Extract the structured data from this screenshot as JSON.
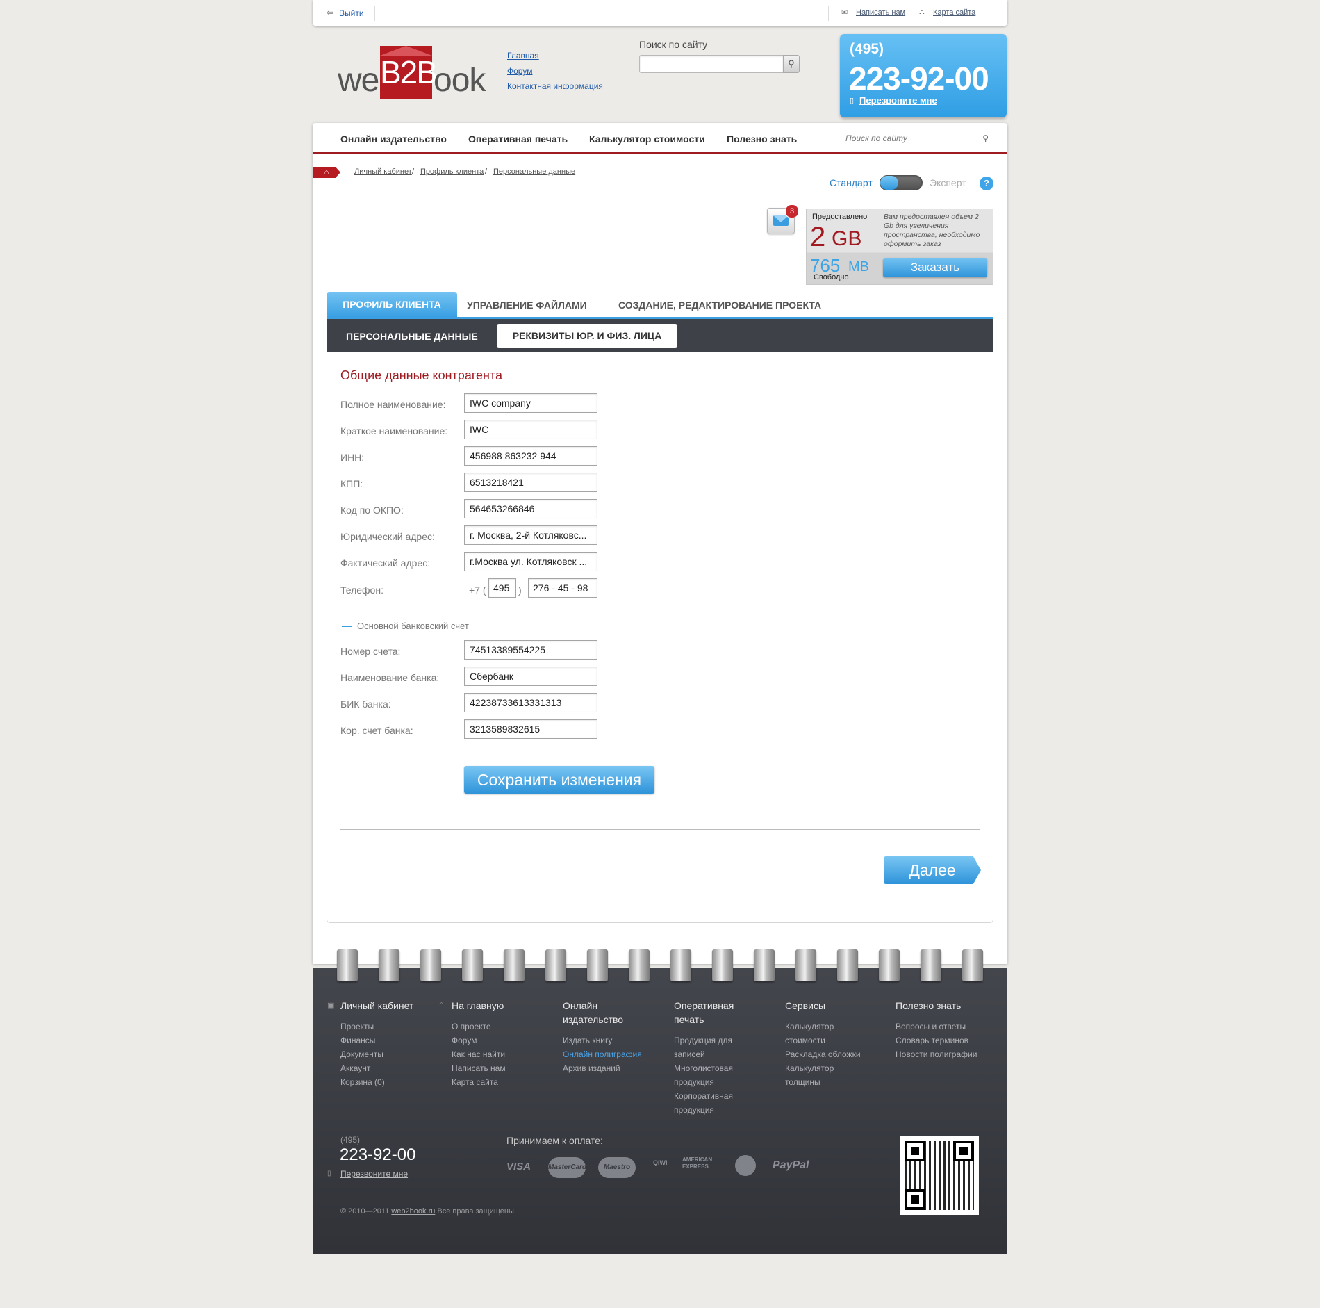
{
  "topbar": {
    "logout": "Выйти",
    "write_us": "Написать нам",
    "sitemap": "Карта сайта"
  },
  "logo": {
    "part1": "we",
    "part2": "B2B",
    "part3": "ook"
  },
  "header_nav": [
    "Главная",
    "Форум",
    "Контактная информация"
  ],
  "search": {
    "label": "Поиск по сайту",
    "value": ""
  },
  "phone": {
    "code": "(495)",
    "number": "223-92-00",
    "callback": "Перезвоните мне"
  },
  "main_nav": {
    "items": [
      "Онлайн издательство",
      "Оперативная печать",
      "Калькулятор стоимости",
      "Полезно знать"
    ],
    "search_placeholder": "Поиск по сайту"
  },
  "breadcrumb": [
    "Личный кабинет",
    "Профиль клиента",
    "Персональные данные"
  ],
  "mode": {
    "standard": "Стандарт",
    "expert": "Эксперт",
    "help": "?"
  },
  "messages": {
    "count": "3"
  },
  "storage": {
    "provided_label": "Предоставлено",
    "provided_value": "2",
    "provided_unit": "GB",
    "note": "Вам предоставлен объем 2 Gb для увеличения пространства, необходимо оформить заказ",
    "free_value": "765",
    "free_unit": "MB",
    "free_label": "Свободно",
    "order_button": "Заказать"
  },
  "tabs": [
    "ПРОФИЛЬ КЛИЕНТА",
    "УПРАВЛЕНИЕ ФАЙЛАМИ",
    "СОЗДАНИЕ, РЕДАКТИРОВАНИЕ ПРОЕКТА"
  ],
  "subtabs": [
    "ПЕРСОНАЛЬНЫЕ ДАННЫЕ",
    "РЕКВИЗИТЫ ЮР. И ФИЗ. ЛИЦА"
  ],
  "form": {
    "title": "Общие данные контрагента",
    "fields": [
      {
        "label": "Полное наименование:",
        "value": "IWC company"
      },
      {
        "label": "Краткое наименование:",
        "value": "IWC"
      },
      {
        "label": "ИНН:",
        "value": "456988 863232 944"
      },
      {
        "label": "КПП:",
        "value": "6513218421"
      },
      {
        "label": "Код по ОКПО:",
        "value": "564653266846"
      },
      {
        "label": "Юридический адрес:",
        "value": "г. Москва, 2-й Котляковс..."
      },
      {
        "label": "Фактический адрес:",
        "value": "г.Москва ул. Котляковск ..."
      }
    ],
    "phone": {
      "label": "Телефон:",
      "prefix": "+7 (",
      "code": "495",
      "close": ")",
      "number": "276 - 45 - 98"
    },
    "bank_title": "Основной банковский счет",
    "bank_fields": [
      {
        "label": "Номер счета:",
        "value": "74513389554225"
      },
      {
        "label": "Наименование банка:",
        "value": "Сбербанк"
      },
      {
        "label": "БИК банка:",
        "value": "42238733613331313"
      },
      {
        "label": "Кор. счет банка:",
        "value": "3213589832615"
      }
    ],
    "save_button": "Сохранить изменения",
    "next_button": "Далее"
  },
  "footer": {
    "columns": [
      {
        "title": "Личный кабинет",
        "links": [
          "Проекты",
          "Финансы",
          "Документы",
          "Аккаунт",
          "Корзина (0)"
        ]
      },
      {
        "title": "На главную",
        "links": [
          "О проекте",
          "Форум",
          "Как нас найти",
          "Написать нам",
          "Карта сайта"
        ]
      },
      {
        "title_lines": [
          "Онлайн",
          "издательство"
        ],
        "links": [
          "Издать книгу",
          "Онлайн полиграфия",
          "Архив изданий"
        ]
      },
      {
        "title_lines": [
          "Оперативная",
          "печать"
        ],
        "links": [
          "Продукция для",
          "записей",
          "Многолистовая",
          "продукция",
          "Корпоративная",
          "продукция"
        ]
      },
      {
        "title": "Сервисы",
        "links": [
          "Калькулятор",
          "стоимости",
          "Раскладка обложки",
          "Калькулятор",
          "толщины"
        ]
      },
      {
        "title": "Полезно знать",
        "links": [
          "Вопросы и ответы",
          "Словарь терминов",
          "Новости полиграфии"
        ]
      }
    ],
    "phone_code": "(495)",
    "phone_number": "223-92-00",
    "callback": "Перезвоните мне",
    "payment_label": "Принимаем к оплате:",
    "payment_logos": [
      "VISA",
      "MasterCard",
      "Maestro",
      "QIWI",
      "AMERICAN EXPRESS",
      "PayPal"
    ],
    "copyright_prefix": "2010—2011",
    "copyright_site": "web2book.ru",
    "copyright_suffix": "Все права защищены"
  },
  "colors": {
    "accent_blue": "#3aa0e3",
    "brand_red": "#b71b22",
    "footer_dark": "#3a3c42"
  }
}
